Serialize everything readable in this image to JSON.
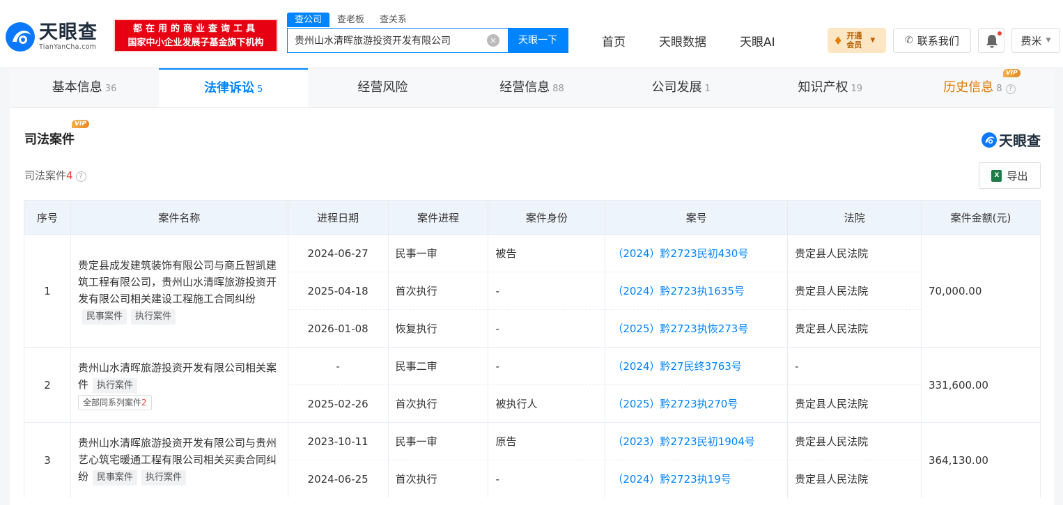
{
  "header": {
    "logo_cn": "天眼查",
    "logo_en": "TianYanCha.com",
    "slogan_line1": "都在用的商业查询工具",
    "slogan_line2": "国家中小企业发展子基金旗下机构",
    "search_tabs": [
      "查公司",
      "查老板",
      "查关系"
    ],
    "search_value": "贵州山水清晖旅游投资开发有限公司",
    "search_button": "天眼一下",
    "nav": [
      "首页",
      "天眼数据",
      "天眼AI"
    ],
    "vip_label": "开通会员",
    "contact_label": "联系我们",
    "user_name": "费米"
  },
  "tabs": [
    {
      "label": "基本信息",
      "count": "36"
    },
    {
      "label": "法律诉讼",
      "count": "5"
    },
    {
      "label": "经营风险",
      "count": ""
    },
    {
      "label": "经营信息",
      "count": "88"
    },
    {
      "label": "公司发展",
      "count": "1"
    },
    {
      "label": "知识产权",
      "count": "19"
    },
    {
      "label": "历史信息",
      "count": "8"
    }
  ],
  "vip_badge": "VIP",
  "section": {
    "title": "司法案件",
    "brand": "天眼查",
    "sub_label": "司法案件",
    "sub_count": "4",
    "export_label": "导出"
  },
  "table": {
    "headers": [
      "序号",
      "案件名称",
      "进程日期",
      "案件进程",
      "案件身份",
      "案号",
      "法院",
      "案件金额(元)"
    ],
    "cases": [
      {
        "no": "1",
        "name": "贵定县成发建筑装饰有限公司与商丘智凯建筑工程有限公司，贵州山水清晖旅游投资开发有限公司相关建设工程施工合同纠纷",
        "tags": [
          "民事案件",
          "执行案件"
        ],
        "amount": "70,000.00",
        "rows": [
          {
            "date": "2024-06-27",
            "stage": "民事一审",
            "role": "被告",
            "case_no": "（2024）黔2723民初430号",
            "court": "贵定县人民法院"
          },
          {
            "date": "2025-04-18",
            "stage": "首次执行",
            "role": "-",
            "case_no": "（2024）黔2723执1635号",
            "court": "贵定县人民法院"
          },
          {
            "date": "2026-01-08",
            "stage": "恢复执行",
            "role": "-",
            "case_no": "（2025）黔2723执恢273号",
            "court": "贵定县人民法院"
          }
        ]
      },
      {
        "no": "2",
        "name": "贵州山水清晖旅游投资开发有限公司相关案件",
        "tags": [
          "执行案件"
        ],
        "series_label": "全部同系列案件",
        "series_count": "2",
        "amount": "331,600.00",
        "rows": [
          {
            "date": "-",
            "stage": "民事二审",
            "role": "-",
            "case_no": "（2024）黔27民终3763号",
            "court": "-"
          },
          {
            "date": "2025-02-26",
            "stage": "首次执行",
            "role": "被执行人",
            "case_no": "（2025）黔2723执270号",
            "court": "贵定县人民法院"
          }
        ]
      },
      {
        "no": "3",
        "name": "贵州山水清晖旅游投资开发有限公司与贵州艺心筑宅暖通工程有限公司相关买卖合同纠纷",
        "tags": [
          "民事案件",
          "执行案件"
        ],
        "amount": "364,130.00",
        "rows": [
          {
            "date": "2023-10-11",
            "stage": "民事一审",
            "role": "原告",
            "case_no": "（2023）黔2723民初1904号",
            "court": "贵定县人民法院"
          },
          {
            "date": "2024-06-25",
            "stage": "首次执行",
            "role": "-",
            "case_no": "（2024）黔2723执19号",
            "court": "贵定县人民法院"
          }
        ]
      }
    ]
  },
  "colors": {
    "accent": "#0084ff",
    "danger": "#f04134",
    "history": "#e07a00"
  }
}
